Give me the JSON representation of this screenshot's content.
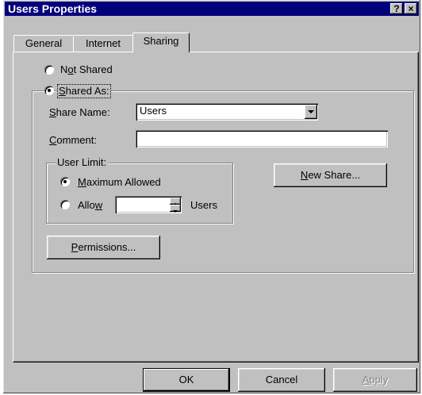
{
  "window": {
    "title": "Users Properties",
    "help_label": "?",
    "close_label": "×"
  },
  "tabs": [
    {
      "label": "General",
      "active": false
    },
    {
      "label": "Internet",
      "active": false
    },
    {
      "label": "Sharing",
      "active": true
    }
  ],
  "sharing": {
    "not_shared_pre": "N",
    "not_shared_ul": "o",
    "not_shared_post": "t Shared",
    "shared_as_ul": "S",
    "shared_as_post": "hared As:",
    "share_name_ul": "S",
    "share_name_post": "hare Name:",
    "share_name_value": "Users",
    "comment_ul": "C",
    "comment_post": "omment:",
    "comment_value": "",
    "user_limit_label": "User Limit:",
    "maximum_ul": "M",
    "maximum_post": "aximum Allowed",
    "allow_pre": "Allo",
    "allow_ul": "w",
    "allow_value": "",
    "users_label": "Users",
    "new_share_ul": "N",
    "new_share_post": "ew Share...",
    "permissions_ul": "P",
    "permissions_post": "ermissions...",
    "selected_option": "Shared As",
    "user_limit_selected": "Maximum Allowed"
  },
  "footer": {
    "ok_label": "OK",
    "cancel_label": "Cancel",
    "apply_pre": "",
    "apply_ul": "A",
    "apply_post": "pply"
  }
}
